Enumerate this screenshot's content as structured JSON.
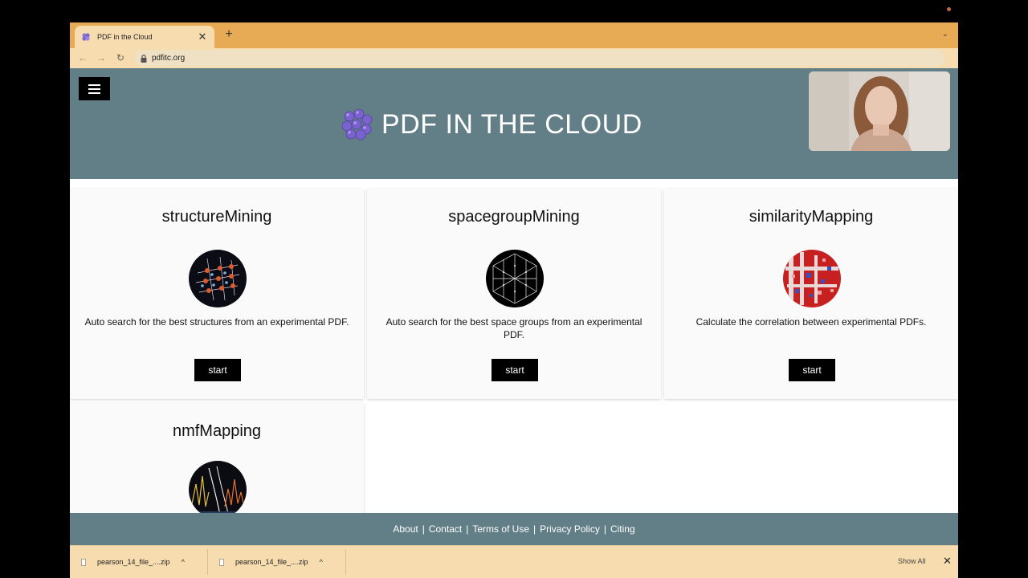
{
  "browser": {
    "tab_title": "PDF in the Cloud",
    "tab_close": "✕",
    "new_tab": "+",
    "tab_menu": "⌄",
    "url": "pdfitc.org",
    "back": "←",
    "forward": "→",
    "reload": "↻",
    "accent_color": "#e8ab55",
    "toolbar_color": "#f6dcae"
  },
  "site": {
    "title": "PDF IN THE CLOUD",
    "header_color": "#627e87"
  },
  "apps": [
    {
      "title": "structureMining",
      "description": "Auto search for the best structures from an experimental PDF.",
      "button": "start",
      "icon": "crystal-structure-icon"
    },
    {
      "title": "spacegroupMining",
      "description": "Auto search for the best space groups from an experimental PDF.",
      "button": "start",
      "icon": "triangular-lattice-icon"
    },
    {
      "title": "similarityMapping",
      "description": "Calculate the correlation between experimental PDFs.",
      "button": "start",
      "icon": "heatmap-icon"
    },
    {
      "title": "nmfMapping",
      "description": "",
      "button": "",
      "icon": "nmf-plot-icon"
    }
  ],
  "footer": {
    "links": [
      "About",
      "Contact",
      "Terms of Use",
      "Privacy Policy",
      "Citing"
    ],
    "separator": "|"
  },
  "downloads": {
    "items": [
      "pearson_14_file_....zip",
      "pearson_14_file_....zip"
    ],
    "caret": "^",
    "show_all": "Show All",
    "close": "✕"
  }
}
